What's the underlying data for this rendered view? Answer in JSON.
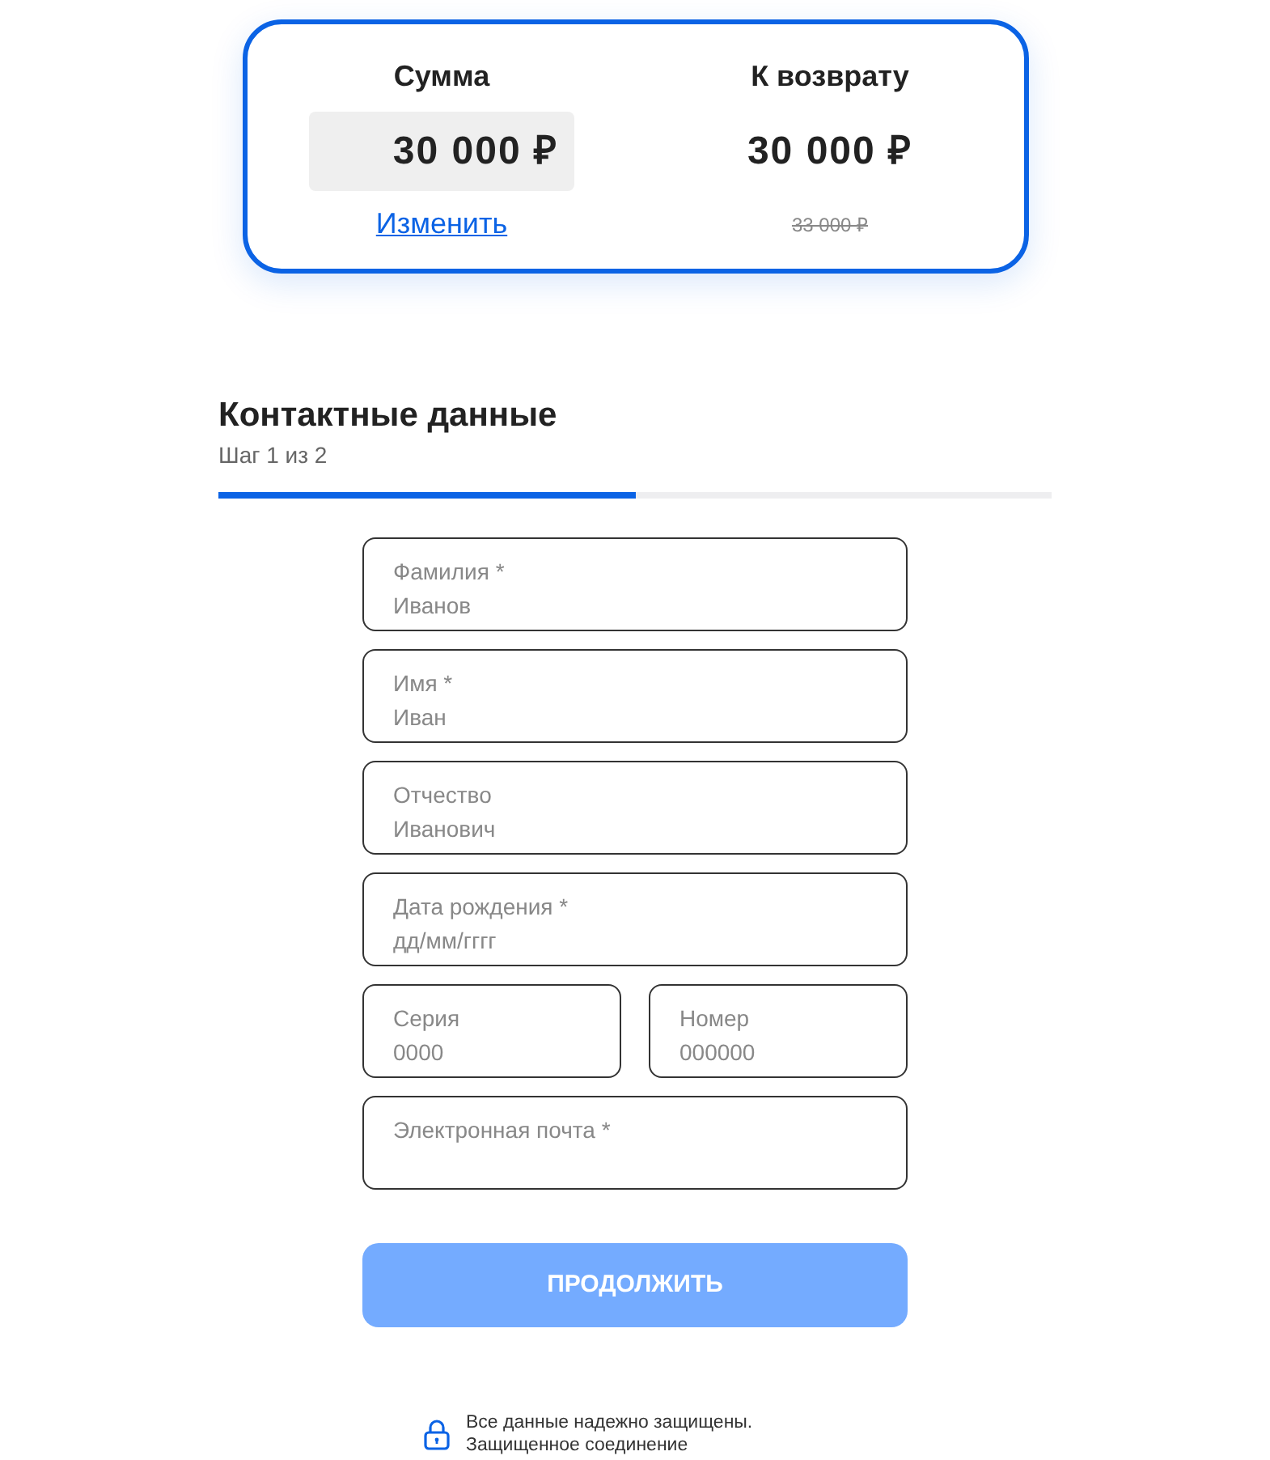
{
  "summary": {
    "amount": {
      "label": "Сумма",
      "value": "30 000 ₽",
      "link": "Изменить"
    },
    "refund": {
      "label": "К возврату",
      "value": "30 000 ₽",
      "old_value": "33 000 ₽"
    }
  },
  "form": {
    "title": "Контактные данные",
    "step": "Шаг 1 из 2",
    "progress": {
      "level": 0.5
    },
    "rows": [
      [
        {
          "label": "Фамилия *",
          "placeholder": "Иванов"
        }
      ],
      [
        {
          "label": "Имя *",
          "placeholder": "Иван"
        }
      ],
      [
        {
          "label": "Отчество",
          "placeholder": "Иванович"
        }
      ],
      [
        {
          "label": "Дата рождения *",
          "placeholder": "дд/мм/гггг"
        }
      ],
      [
        {
          "label": "Серия",
          "placeholder": "0000"
        },
        {
          "label": "Номер",
          "placeholder": "000000"
        }
      ],
      [
        {
          "label": "Электронная почта *"
        }
      ]
    ],
    "submit": {
      "label": "ПРОДОЛЖИТЬ",
      "disabled": true
    },
    "security": {
      "line1": "Все данные надежно защищены.",
      "line2": "Защищенное соединение"
    }
  }
}
